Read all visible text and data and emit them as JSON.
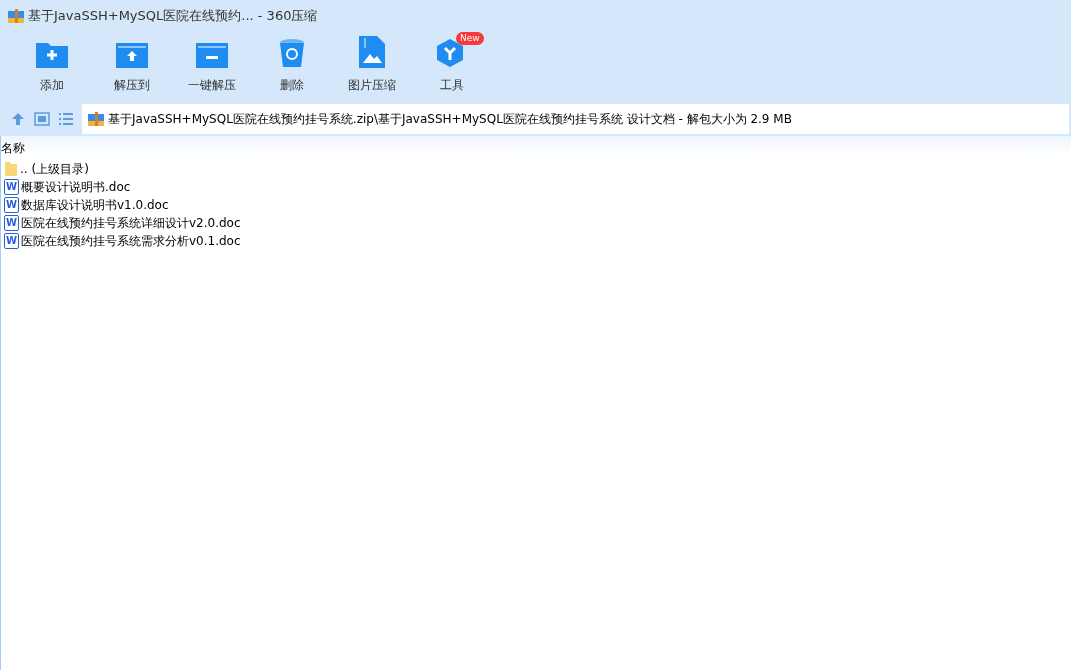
{
  "window": {
    "title": "基于JavaSSH+MySQL医院在线预约... - 360压缩"
  },
  "toolbar": [
    {
      "kind": "add",
      "label": "添加"
    },
    {
      "kind": "extract-to",
      "label": "解压到"
    },
    {
      "kind": "one-click",
      "label": "一键解压"
    },
    {
      "kind": "delete",
      "label": "删除"
    },
    {
      "kind": "image",
      "label": "图片压缩"
    },
    {
      "kind": "tools",
      "label": "工具",
      "badge": "New"
    }
  ],
  "address": {
    "path": "基于JavaSSH+MySQL医院在线预约挂号系统.zip\\基于JavaSSH+MySQL医院在线预约挂号系统 设计文档 - 解包大小为 2.9 MB"
  },
  "table": {
    "columns": [
      "名称"
    ],
    "rows": [
      {
        "kind": "folder",
        "name": ".. (上级目录)"
      },
      {
        "kind": "doc",
        "icon_text": "W",
        "name": "概要设计说明书.doc"
      },
      {
        "kind": "doc",
        "icon_text": "W",
        "name": "数据库设计说明书v1.0.doc"
      },
      {
        "kind": "doc",
        "icon_text": "W",
        "name": "医院在线预约挂号系统详细设计v2.0.doc"
      },
      {
        "kind": "doc",
        "icon_text": "W",
        "name": "医院在线预约挂号系统需求分析v0.1.doc"
      }
    ]
  }
}
